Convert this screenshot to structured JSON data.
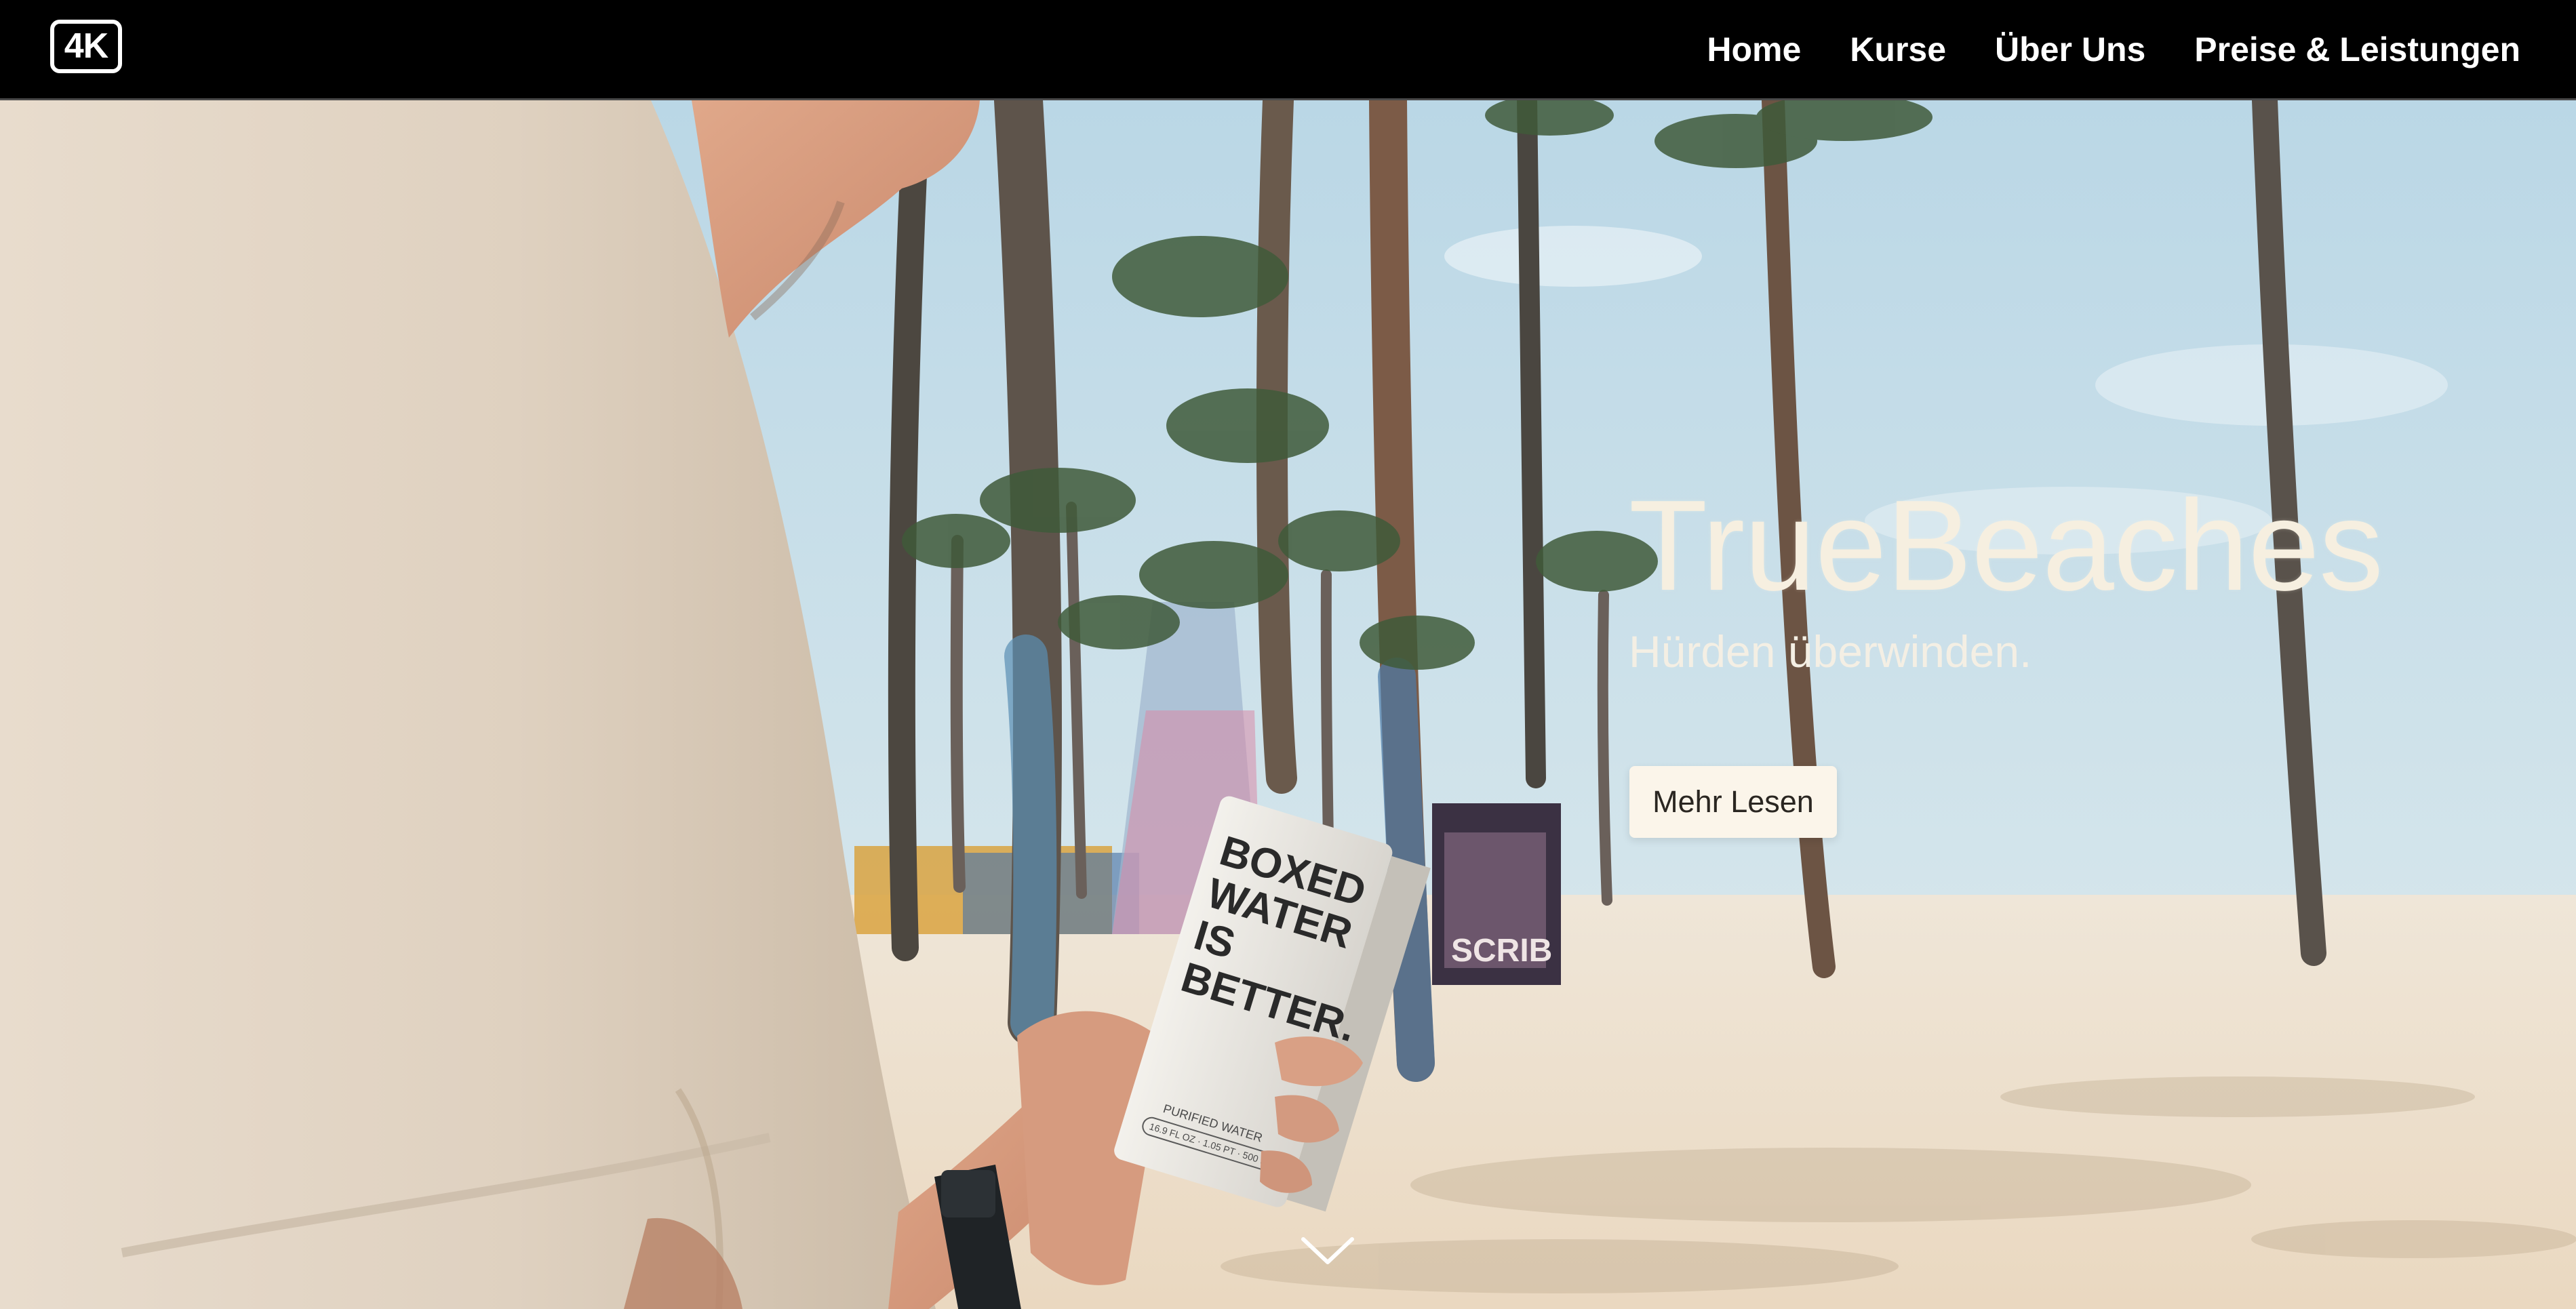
{
  "header": {
    "logo_text": "4K",
    "nav": [
      {
        "label": "Home"
      },
      {
        "label": "Kurse"
      },
      {
        "label": "Über Uns"
      },
      {
        "label": "Preise & Leistungen"
      }
    ]
  },
  "hero": {
    "title": "TrueBeaches",
    "subtitle": "Hürden überwinden.",
    "cta_label": "Mehr Lesen",
    "scroll_icon": "chevron-down-icon"
  },
  "carton": {
    "line1": "BOXED",
    "line2": "WATER",
    "line3": "IS",
    "line4": "BETTER.",
    "caption": "PURIFIED WATER",
    "volume": "16.9 FL OZ · 1.05 PT · 500 ML"
  },
  "colors": {
    "sky": "#cfe3ec",
    "sand": "#f1e4d1",
    "headline": "#f6efe0",
    "cta_background": "#fbf5ea",
    "topbar": "#000000"
  }
}
